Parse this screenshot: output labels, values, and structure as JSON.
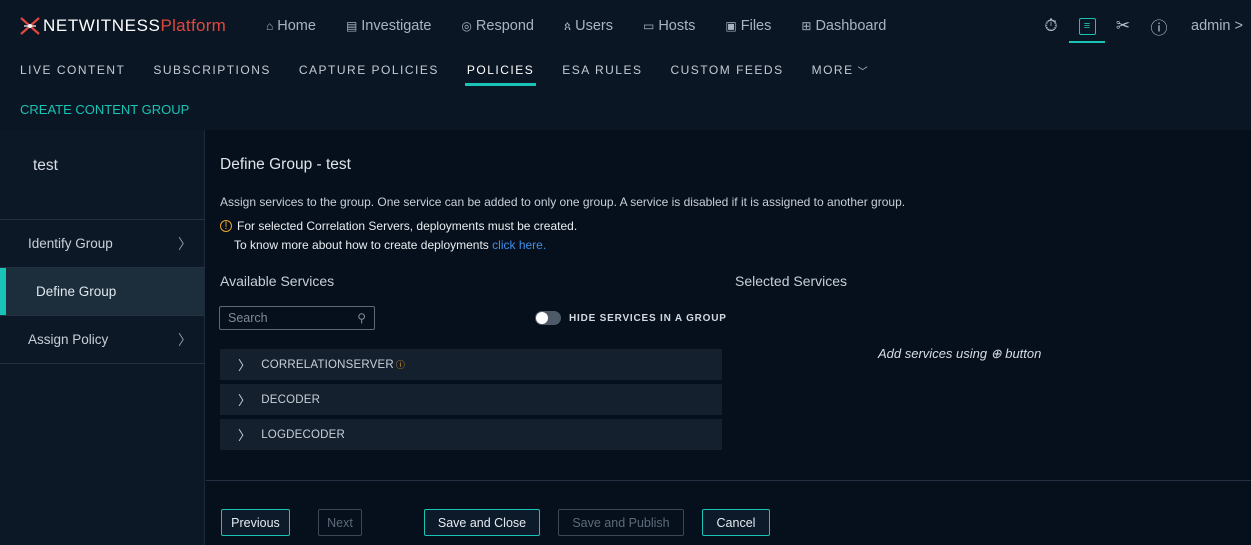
{
  "header": {
    "logo_primary": "NETWITNESS",
    "logo_secondary": "Platform",
    "nav": [
      {
        "icon": "⌂",
        "label": "Home"
      },
      {
        "icon": "▤",
        "label": "Investigate"
      },
      {
        "icon": "◎",
        "label": "Respond"
      },
      {
        "icon": "ጰ",
        "label": "Users"
      },
      {
        "icon": "▭",
        "label": "Hosts"
      },
      {
        "icon": "▣",
        "label": "Files"
      },
      {
        "icon": "⊞",
        "label": "Dashboard"
      }
    ],
    "right_icons": [
      "stopwatch-icon",
      "configure-icon",
      "tools-icon",
      "help-icon"
    ],
    "user": "admin >"
  },
  "subnav": {
    "items": [
      "LIVE CONTENT",
      "SUBSCRIPTIONS",
      "CAPTURE POLICIES",
      "POLICIES",
      "ESA RULES",
      "CUSTOM FEEDS"
    ],
    "more": "MORE"
  },
  "actions": {
    "create": "CREATE CONTENT GROUP"
  },
  "sidebar": {
    "title": "test",
    "steps": [
      "Identify Group",
      "Define Group",
      "Assign Policy"
    ]
  },
  "main": {
    "title": "Define Group - test",
    "description": "Assign services to the group. One service can be added to only one group. A service is disabled if it is assigned to another group.",
    "warning_line1": "For selected Correlation Servers, deployments must be created.",
    "warning_line2": "To know more about how to create deployments",
    "warning_link": "click here.",
    "available_title": "Available Services",
    "selected_title": "Selected Services",
    "search_placeholder": "Search",
    "toggle_label": "HIDE SERVICES IN A GROUP",
    "services": [
      "CORRELATIONSERVER",
      "DECODER",
      "LOGDECODER"
    ],
    "empty_message": "Add services using ⊕ button"
  },
  "footer": {
    "previous": "Previous",
    "next": "Next",
    "save_close": "Save and Close",
    "save_publish": "Save and Publish",
    "cancel": "Cancel"
  },
  "colors": {
    "accent": "#19c3b5",
    "warning": "#e7a32d",
    "link": "#3f8fe8",
    "brand_red": "#e0483e"
  }
}
